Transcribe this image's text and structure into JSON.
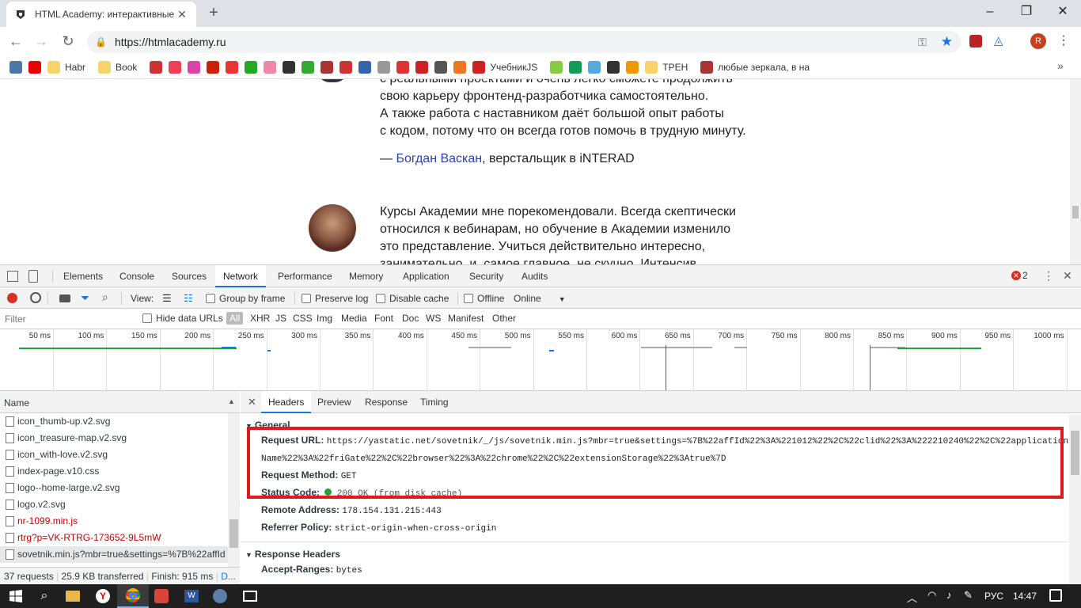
{
  "browser": {
    "tab_title": "HTML Academy: интерактивные",
    "url": "https://htmlacademy.ru",
    "bookmarks": [
      {
        "label": "",
        "icon": "vk-icon",
        "color": "#4a76a8"
      },
      {
        "label": "",
        "icon": "youtube-icon",
        "color": "#e00"
      },
      {
        "label": "Habr",
        "icon": "folder-icon",
        "color": "#f6d46b"
      },
      {
        "label": "Book",
        "icon": "folder-icon",
        "color": "#f6d46b"
      },
      {
        "label": "",
        "icon": "red-icon",
        "color": "#c33"
      },
      {
        "label": "",
        "icon": "pocket-icon",
        "color": "#ef4056"
      },
      {
        "label": "",
        "icon": "star-colored-icon",
        "color": "#d4a"
      },
      {
        "label": "",
        "icon": "red-star-icon",
        "color": "#c20"
      },
      {
        "label": "",
        "icon": "lf-icon",
        "color": "#e33"
      },
      {
        "label": "",
        "icon": "green-icon",
        "color": "#2a2"
      },
      {
        "label": "",
        "icon": "chrome-color-icon",
        "color": "#e8a"
      },
      {
        "label": "",
        "icon": "bs-icon",
        "color": "#333"
      },
      {
        "label": "",
        "icon": "two-icon",
        "color": "#3a3"
      },
      {
        "label": "",
        "icon": "ants-icon",
        "color": "#a33"
      },
      {
        "label": "",
        "icon": "bars-icon",
        "color": "#c33"
      },
      {
        "label": "",
        "icon": "blue-square-icon",
        "color": "#36a"
      },
      {
        "label": "",
        "icon": "doc-icon",
        "color": "#999"
      },
      {
        "label": "",
        "icon": "gear-red-icon",
        "color": "#d33"
      },
      {
        "label": "",
        "icon": "chart-icon",
        "color": "#c22"
      },
      {
        "label": "",
        "icon": "shield-icon",
        "color": "#555"
      },
      {
        "label": "",
        "icon": "orange-icon",
        "color": "#e72"
      },
      {
        "label": "УчебникJS",
        "icon": "js-icon",
        "color": "#c22"
      },
      {
        "label": "",
        "icon": "colors-icon",
        "color": "#8c4"
      },
      {
        "label": "",
        "icon": "sheets-icon",
        "color": "#0f9d58"
      },
      {
        "label": "",
        "icon": "bird-icon",
        "color": "#5ad"
      },
      {
        "label": "",
        "icon": "home-icon",
        "color": "#333"
      },
      {
        "label": "",
        "icon": "ru-icon",
        "color": "#e90"
      },
      {
        "label": "ТРЕН",
        "icon": "folder-icon",
        "color": "#f6d46b"
      },
      {
        "label": "любые зеркала, в на",
        "icon": "ants-icon",
        "color": "#a33"
      }
    ]
  },
  "page": {
    "lines_top": [
      "с реальными проектами и очень легко сможете продолжить",
      "свою карьеру фронтенд-разработчика самостоятельно.",
      "А также работа с наставником даёт большой опыт работы",
      "с кодом, потому что он всегда готов помочь в трудную минуту."
    ],
    "author_dash": "—",
    "author_name": "Богдан Васкан",
    "author_role": ", верстальщик в iNTERAD",
    "lines_second": [
      "Курсы Академии мне порекомендовали. Всегда скептически",
      "относился к вебинарам, но обучение в Академии изменило",
      "это представление. Учиться действительно интересно,",
      "занимательно, и, самое главное, не скучно. Интенсив"
    ]
  },
  "devtools": {
    "tabs": [
      "Elements",
      "Console",
      "Sources",
      "Network",
      "Performance",
      "Memory",
      "Application",
      "Security",
      "Audits"
    ],
    "active_tab": "Network",
    "error_count": "2",
    "view_label": "View:",
    "group_by_frame": "Group by frame",
    "preserve_log": "Preserve log",
    "disable_cache": "Disable cache",
    "offline": "Offline",
    "throttle": "Online",
    "filter_placeholder": "Filter",
    "hide_data_urls": "Hide data URLs",
    "types": [
      "All",
      "XHR",
      "JS",
      "CSS",
      "Img",
      "Media",
      "Font",
      "Doc",
      "WS",
      "Manifest",
      "Other"
    ],
    "timeline_ticks": [
      "50 ms",
      "100 ms",
      "150 ms",
      "200 ms",
      "250 ms",
      "300 ms",
      "350 ms",
      "400 ms",
      "450 ms",
      "500 ms",
      "550 ms",
      "600 ms",
      "650 ms",
      "700 ms",
      "750 ms",
      "800 ms",
      "850 ms",
      "900 ms",
      "950 ms",
      "1000 ms"
    ],
    "name_header": "Name",
    "files": [
      {
        "name": "icon_thumb-up.v2.svg",
        "color": "#303942"
      },
      {
        "name": "icon_treasure-map.v2.svg",
        "color": "#303942"
      },
      {
        "name": "icon_with-love.v2.svg",
        "color": "#303942"
      },
      {
        "name": "index-page.v10.css",
        "color": "#303942"
      },
      {
        "name": "logo--home-large.v2.svg",
        "color": "#303942"
      },
      {
        "name": "logo.v2.svg",
        "color": "#303942"
      },
      {
        "name": "nr-1099.min.js",
        "color": "#c00"
      },
      {
        "name": "rtrg?p=VK-RTRG-173652-9L5mW",
        "color": "#c00"
      },
      {
        "name": "sovetnik.min.js?mbr=true&settings=%7B%22affId",
        "color": "#303942"
      }
    ],
    "status_bar": {
      "requests": "37 requests",
      "transferred": "25.9 KB transferred",
      "finish": "Finish: 915 ms",
      "more": "D..."
    },
    "detail_tabs": [
      "Headers",
      "Preview",
      "Response",
      "Timing"
    ],
    "general_title": "General",
    "general": {
      "request_url_key": "Request URL:",
      "request_url_line1": "https://yastatic.net/sovetnik/_/js/sovetnik.min.js?mbr=true&settings=%7B%22affId%22%3A%221012%22%2C%22clid%22%3A%222210240%22%2C%22application",
      "request_url_line2": "Name%22%3A%22friGate%22%2C%22browser%22%3A%22chrome%22%2C%22extensionStorage%22%3Atrue%7D",
      "method_key": "Request Method:",
      "method_val": "GET",
      "status_key": "Status Code:",
      "status_val": "200 OK (from disk cache)",
      "remote_key": "Remote Address:",
      "remote_val": "178.154.131.215:443",
      "referrer_key": "Referrer Policy:",
      "referrer_val": "strict-origin-when-cross-origin"
    },
    "response_headers_title": "Response Headers",
    "accept_ranges_key": "Accept-Ranges:",
    "accept_ranges_val": "bytes"
  },
  "taskbar": {
    "lang": "РУС",
    "time": "14:47"
  },
  "colors": {
    "highlight_box": "#e0191e",
    "accent": "#1a73e8",
    "link": "#2b3fb5"
  }
}
